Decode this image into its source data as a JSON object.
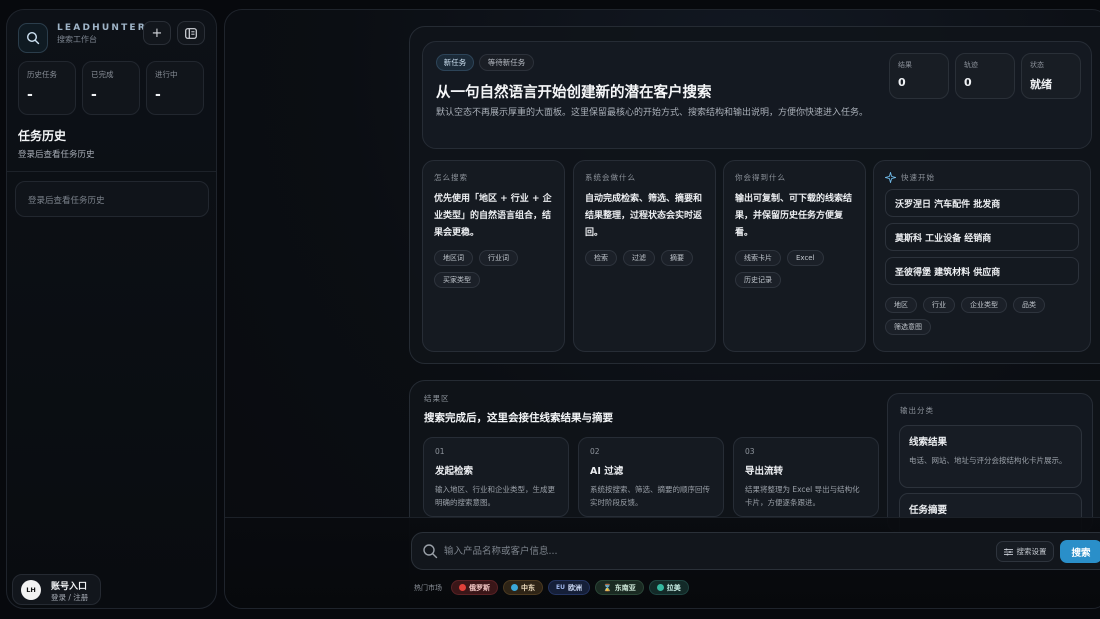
{
  "sidebar": {
    "brand_name": "LEADHUNTER",
    "brand_sub": "搜索工作台",
    "new_button": "+",
    "stats": [
      {
        "label": "历史任务",
        "value": "-"
      },
      {
        "label": "已完成",
        "value": "-"
      },
      {
        "label": "进行中",
        "value": "-"
      }
    ],
    "history_title": "任务历史",
    "history_subtitle": "登录后查看任务历史",
    "history_empty": "登录后查看任务历史",
    "account": {
      "avatar": "LH",
      "title": "账号入口",
      "subtitle": "登录 / 注册"
    }
  },
  "hero": {
    "badge_new": "新任务",
    "badge_wait": "等待新任务",
    "title": "从一句自然语言开始创建新的潜在客户搜索",
    "description": "默认空态不再展示厚重的大面板。这里保留最核心的开始方式、搜索结构和输出说明，方便你快速进入任务。",
    "mini_stats": [
      {
        "label": "结果",
        "value": "0"
      },
      {
        "label": "轨迹",
        "value": "0"
      },
      {
        "label": "状态",
        "value": "就绪"
      }
    ]
  },
  "cards": [
    {
      "label": "怎么搜索",
      "body": "优先使用「地区 + 行业 + 企业类型」的自然语言组合，结果会更稳。",
      "tags": [
        "地区词",
        "行业词",
        "买家类型"
      ]
    },
    {
      "label": "系统会做什么",
      "body": "自动完成检索、筛选、摘要和结果整理，过程状态会实时返回。",
      "tags": [
        "检索",
        "过滤",
        "摘要"
      ]
    },
    {
      "label": "你会得到什么",
      "body": "输出可复制、可下载的线索结果，并保留历史任务方便复看。",
      "tags": [
        "线索卡片",
        "Excel",
        "历史记录"
      ]
    }
  ],
  "quick_start": {
    "label": "快速开始",
    "items": [
      "沃罗涅日 汽车配件 批发商",
      "莫斯科 工业设备 经销商",
      "圣彼得堡 建筑材料 供应商"
    ],
    "tags": [
      "地区",
      "行业",
      "企业类型",
      "品类",
      "筛选意图"
    ]
  },
  "results": {
    "label": "结果区",
    "title": "搜索完成后，这里会接住线索结果与摘要",
    "steps": [
      {
        "num": "01",
        "title": "发起检索",
        "desc": "输入地区、行业和企业类型，生成更明确的搜索意图。"
      },
      {
        "num": "02",
        "title": "AI 过滤",
        "desc": "系统按搜索、筛选、摘要的顺序回传实时阶段反馈。"
      },
      {
        "num": "03",
        "title": "导出流转",
        "desc": "结果将整理为 Excel 导出与结构化卡片，方便逐条跟进。"
      }
    ],
    "output_label": "输出分类",
    "outputs": [
      {
        "title": "线索结果",
        "desc": "电话、网站、地址与评分会按结构化卡片展示。"
      },
      {
        "title": "任务摘要",
        "desc": ""
      }
    ]
  },
  "search": {
    "placeholder": "输入产品名称或客户信息...",
    "settings_label": "搜索设置",
    "button_label": "搜索",
    "markets_label": "热门市场",
    "markets": [
      {
        "label": "俄罗斯",
        "color": "#e0413a"
      },
      {
        "label": "中东",
        "color": "#3aa7d8"
      },
      {
        "label": "欧洲",
        "color": "#3f6fd6"
      },
      {
        "label": "东南亚",
        "color": "#d8a83a"
      },
      {
        "label": "拉美",
        "color": "#35b8a0"
      }
    ]
  }
}
